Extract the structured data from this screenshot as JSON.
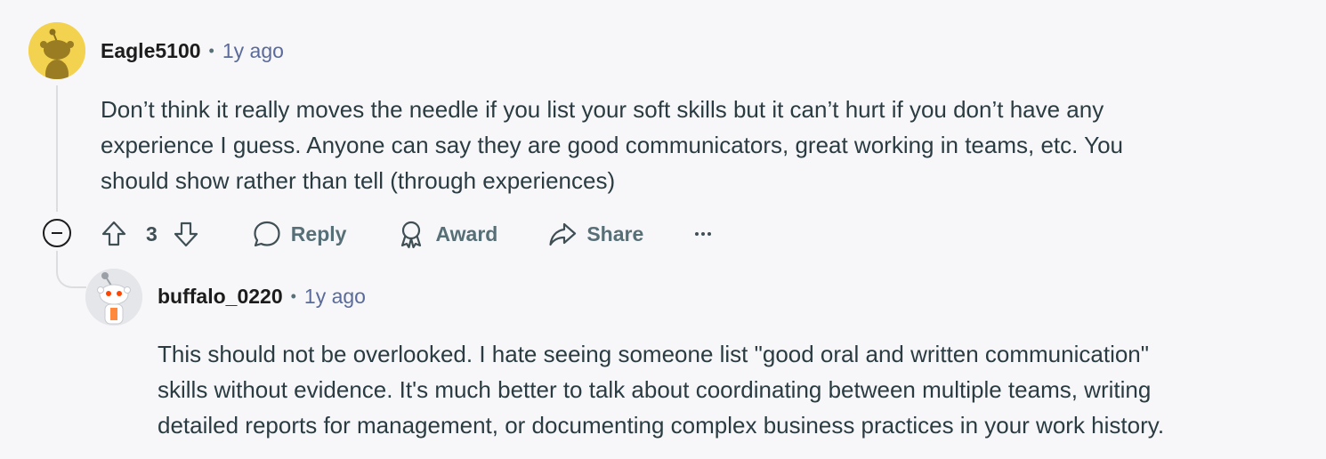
{
  "comments": [
    {
      "username": "Eagle5100",
      "separator": "•",
      "time": "1y ago",
      "avatar_color": "#f3d250",
      "avatar_icon": "snoo-avatar-icon",
      "body_lines": [
        "Don’t think it really moves the needle if you list your soft skills but it can’t hurt if you don’t have any",
        "experience I guess. Anyone can say they are good communicators, great working in teams, etc. You",
        "should show rather than tell (through experiences)"
      ],
      "actions": {
        "upvote_icon": "arrow-up-icon",
        "score": "3",
        "downvote_icon": "arrow-down-icon",
        "reply": "Reply",
        "award": "Award",
        "share": "Share",
        "more_icon": "ellipsis-icon"
      }
    },
    {
      "username": "buffalo_0220",
      "separator": "•",
      "time": "1y ago",
      "avatar_color": "#e4e6ea",
      "avatar_icon": "snoo-avatar-icon",
      "body_lines": [
        "This should not be overlooked. I hate seeing someone list \"good oral and written communication\"",
        "skills without evidence. It's much better to talk about coordinating between multiple teams, writing",
        "detailed reports for management, or documenting complex business practices in your work history."
      ]
    }
  ],
  "collapse_icon": "collapse-minus-icon"
}
